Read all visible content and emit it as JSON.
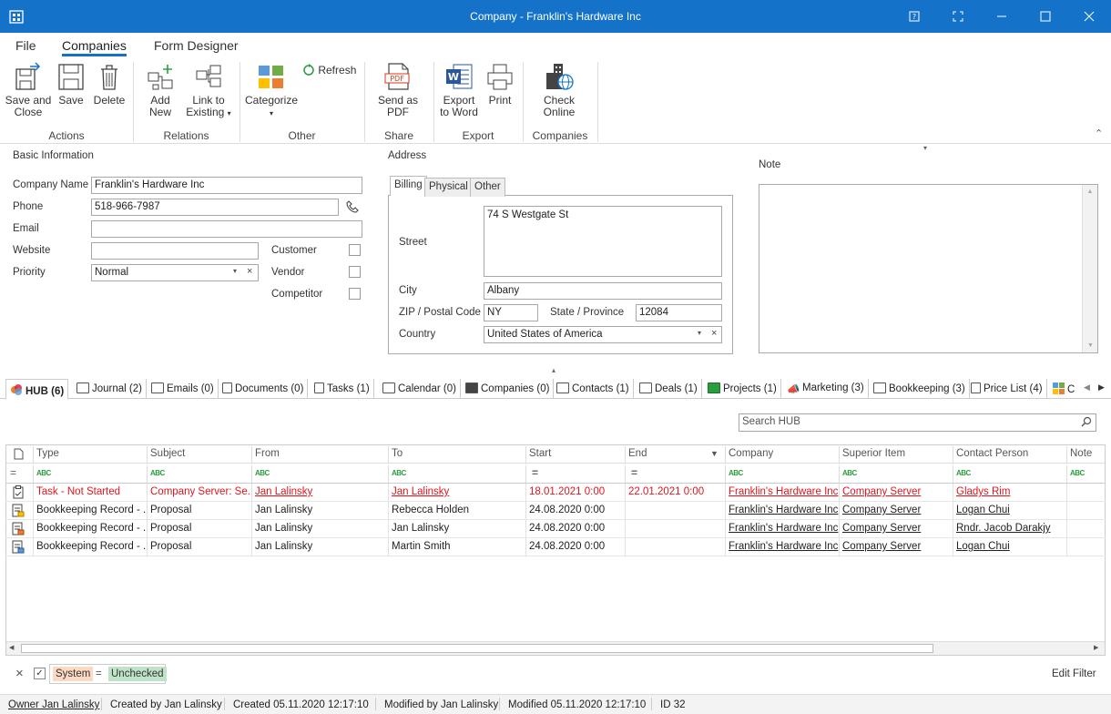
{
  "window": {
    "title": "Company - Franklin's Hardware Inc"
  },
  "menu": {
    "file": "File",
    "companies": "Companies",
    "form_designer": "Form Designer"
  },
  "ribbon": {
    "save_close": [
      "Save and",
      "Close"
    ],
    "save": "Save",
    "delete": "Delete",
    "add_new": "Add New",
    "link_existing": [
      "Link to",
      "Existing"
    ],
    "categorize": "Categorize",
    "refresh": "Refresh",
    "send_pdf": "Send as PDF",
    "export_word": [
      "Export",
      "to Word"
    ],
    "print": "Print",
    "check_online": [
      "Check",
      "Online"
    ],
    "pdf_badge": "PDF",
    "groups": {
      "actions": "Actions",
      "relations": "Relations",
      "other": "Other",
      "share": "Share",
      "export": "Export",
      "companies": "Companies"
    }
  },
  "basic": {
    "heading": "Basic Information",
    "company_name_label": "Company Name",
    "company_name": "Franklin's Hardware Inc",
    "phone_label": "Phone",
    "phone": "518-966-7987",
    "email_label": "Email",
    "email": "",
    "website_label": "Website",
    "website": "",
    "priority_label": "Priority",
    "priority": "Normal",
    "customer_label": "Customer",
    "vendor_label": "Vendor",
    "competitor_label": "Competitor"
  },
  "address": {
    "heading": "Address",
    "tabs": [
      "Billing",
      "Physical",
      "Other"
    ],
    "street_label": "Street",
    "street": "74 S Westgate St",
    "city_label": "City",
    "city": "Albany",
    "zip_label": "ZIP / Postal Code",
    "zip": "NY",
    "state_label": "State / Province",
    "state": "12084",
    "country_label": "Country",
    "country": "United States of America"
  },
  "note": {
    "heading": "Note"
  },
  "hub_tabs": [
    "HUB (6)",
    "Journal (2)",
    "Emails (0)",
    "Documents (0)",
    "Tasks (1)",
    "Calendar (0)",
    "Companies (0)",
    "Contacts (1)",
    "Deals (1)",
    "Projects (1)",
    "Marketing (3)",
    "Bookkeeping (3)",
    "Price List (4)",
    "C"
  ],
  "search": {
    "placeholder": "Search HUB"
  },
  "grid": {
    "columns": [
      "Type",
      "Subject",
      "From",
      "To",
      "Start",
      "End",
      "Company",
      "Superior Item",
      "Contact Person",
      "Note"
    ],
    "rows": [
      {
        "type": "Task - Not Started",
        "subject": "Company Server: Se...",
        "from": "Jan Lalinsky",
        "to": "Jan Lalinsky",
        "start": "18.01.2021 0:00",
        "end": "22.01.2021 0:00",
        "company": "Franklin's Hardware Inc",
        "superior": "Company Server",
        "contact": "Gladys Rim"
      },
      {
        "type": "Bookkeeping Record - ...",
        "subject": "Proposal",
        "from": "Jan Lalinsky",
        "to": "Rebecca Holden",
        "start": "24.08.2020 0:00",
        "end": "",
        "company": "Franklin's Hardware Inc",
        "superior": "Company Server",
        "contact": "Logan Chui"
      },
      {
        "type": "Bookkeeping Record - ...",
        "subject": "Proposal",
        "from": "Jan Lalinsky",
        "to": "Jan Lalinsky",
        "start": "24.08.2020 0:00",
        "end": "",
        "company": "Franklin's Hardware Inc",
        "superior": "Company Server",
        "contact": "Rndr. Jacob Darakjy"
      },
      {
        "type": "Bookkeeping Record - ...",
        "subject": "Proposal",
        "from": "Jan Lalinsky",
        "to": "Martin Smith",
        "start": "24.08.2020 0:00",
        "end": "",
        "company": "Franklin's Hardware Inc",
        "superior": "Company Server",
        "contact": "Logan Chui"
      }
    ]
  },
  "filter": {
    "field": "System",
    "op": "=",
    "value": "Unchecked",
    "edit": "Edit Filter",
    "abc": "ABC",
    "eq": "="
  },
  "status": {
    "owner": "Owner Jan Lalinsky",
    "created_by": "Created by Jan Lalinsky",
    "created": "Created 05.11.2020 12:17:10",
    "modified_by": "Modified by Jan Lalinsky",
    "modified": "Modified 05.11.2020 12:17:10",
    "id": "ID 32"
  },
  "colors": {
    "accent": "#1473c9",
    "red": "#e0141e"
  }
}
